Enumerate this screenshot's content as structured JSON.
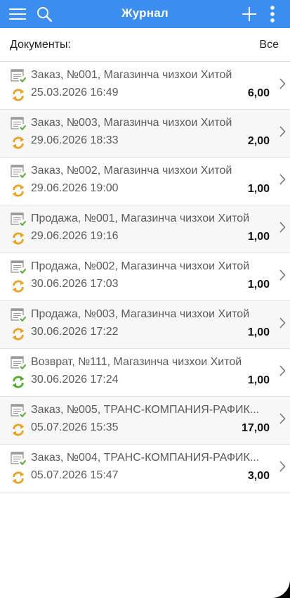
{
  "appbar": {
    "title": "Журнал",
    "icons": [
      "menu-icon",
      "search-icon",
      "plus-icon",
      "more-vert-icon"
    ],
    "color": "#3b8ef0"
  },
  "filter": {
    "label": "Документы:",
    "value": "Все"
  },
  "documents": [
    {
      "title": "Заказ, №001, Магазинча чизхои Хитой",
      "datetime": "25.03.2026 16:49",
      "amount": "6,00",
      "sync": "orange"
    },
    {
      "title": "Заказ, №003, Магазинча чизхои Хитой",
      "datetime": "29.06.2026 18:33",
      "amount": "2,00",
      "sync": "orange"
    },
    {
      "title": "Заказ, №002, Магазинча чизхои Хитой",
      "datetime": "29.06.2026 19:00",
      "amount": "1,00",
      "sync": "orange"
    },
    {
      "title": "Продажа, №001, Магазинча чизхои Хитой",
      "datetime": "29.06.2026 19:16",
      "amount": "1,00",
      "sync": "orange"
    },
    {
      "title": "Продажа, №002, Магазинча чизхои Хитой",
      "datetime": "30.06.2026 17:03",
      "amount": "1,00",
      "sync": "orange"
    },
    {
      "title": "Продажа, №003, Магазинча чизхои Хитой",
      "datetime": "30.06.2026 17:22",
      "amount": "1,00",
      "sync": "orange"
    },
    {
      "title": "Возврат, №111, Магазинча чизхои Хитой",
      "datetime": "30.06.2026 17:24",
      "amount": "1,00",
      "sync": "green"
    },
    {
      "title": "Заказ, №005,  ТРАНС-КОМПАНИЯ-РАФИК...",
      "datetime": "05.07.2026 15:35",
      "amount": "17,00",
      "sync": "orange"
    },
    {
      "title": "Заказ, №004,  ТРАНС-КОМПАНИЯ-РАФИК...",
      "datetime": "05.07.2026 15:47",
      "amount": "3,00",
      "sync": "orange"
    }
  ],
  "colors": {
    "sync_orange": "#f0a020",
    "sync_green": "#4caf2a",
    "check_green": "#4caf2a"
  }
}
